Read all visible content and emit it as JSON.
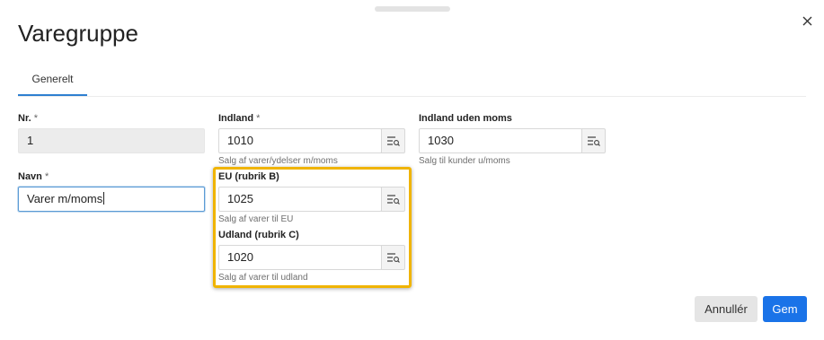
{
  "dialog": {
    "title": "Varegruppe",
    "close_label": "×"
  },
  "tabs": [
    {
      "label": "Generelt",
      "active": true
    }
  ],
  "fields": {
    "nr": {
      "label": "Nr.",
      "required_mark": "*",
      "value": "1"
    },
    "navn": {
      "label": "Navn",
      "required_mark": "*",
      "value": "Varer m/moms"
    },
    "indland": {
      "label": "Indland",
      "required_mark": "*",
      "value": "1010",
      "hint": "Salg af varer/ydelser m/moms"
    },
    "indland_uden_moms": {
      "label": "Indland uden moms",
      "value": "1030",
      "hint": "Salg til kunder u/moms"
    },
    "eu": {
      "label": "EU (rubrik B)",
      "value": "1025",
      "hint": "Salg af varer til EU"
    },
    "udland": {
      "label": "Udland (rubrik C)",
      "value": "1020",
      "hint": "Salg af varer til udland"
    }
  },
  "buttons": {
    "cancel": "Annullér",
    "save": "Gem"
  },
  "colors": {
    "accent": "#1a73e8",
    "tab_underline": "#2e7fd0",
    "highlight": "#f0b400"
  },
  "icons": {
    "lookup": "list-search-icon",
    "close": "close-icon"
  }
}
